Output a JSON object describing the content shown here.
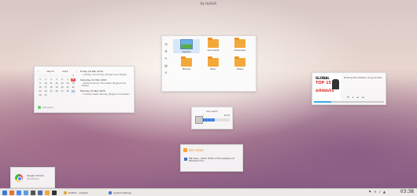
{
  "page": {
    "title": "By HalFeR"
  },
  "calendar": {
    "nav_prev": "‹",
    "month": "March",
    "year": "2015",
    "nav_next": "›",
    "days": [
      "",
      "",
      "",
      "",
      "",
      "",
      "1",
      "2",
      "3",
      "4",
      "5",
      "6",
      "7",
      "8",
      "9",
      "10",
      "11",
      "12",
      "13",
      "14",
      "15",
      "16",
      "17",
      "18",
      "19",
      "20",
      "21",
      "22",
      "23",
      "24",
      "25",
      "26",
      "27",
      "28",
      "29",
      "30",
      "31",
      "",
      "",
      "",
      "",
      ""
    ],
    "today_index": 13,
    "selected_index": 34,
    "events": [
      {
        "day": "Friday 20 Mar 2015",
        "text": "Holiday: Good Friday (England and Wales)"
      },
      {
        "day": "Saturday 21 Mar 2015",
        "text": "British Summer Time starts (England and Wales)"
      },
      {
        "day": "Monday 23 Mar 2015",
        "text": "Holiday: Easter Monday (England and Wales)"
      }
    ],
    "add_placeholder": "Add event..."
  },
  "folderview": {
    "tools": [
      "☰",
      "⚙",
      "✎",
      "▤",
      "✕"
    ],
    "items": [
      {
        "label": "Desktop",
        "kind": "desktop",
        "selected": true
      },
      {
        "label": "Documents",
        "kind": "folder",
        "selected": false
      },
      {
        "label": "Downloads",
        "kind": "folder",
        "selected": false
      },
      {
        "label": "Pictures",
        "kind": "folder",
        "selected": false
      },
      {
        "label": "Music",
        "kind": "folder",
        "selected": false
      },
      {
        "label": "Videos",
        "kind": "folder",
        "selected": false
      }
    ]
  },
  "music": {
    "cover_line1": "GLOBAL",
    "cover_line2": "TOP 15",
    "cover_line3": "AIRWAVES",
    "title": "Nothing Else Matters (Original Mix)",
    "controls": [
      "⏮",
      "⏸",
      "⏭",
      "⏭"
    ],
    "progress": 0.25,
    "accent": "#3daee9"
  },
  "disk": {
    "header": "Disk Watch",
    "left": "/",
    "right": "98 GB",
    "used_fraction": 0.45
  },
  "rss": {
    "header": "BBC NEWS",
    "items": [
      {
        "text": "BBC News - Watch: Britain's first Alphabet and Wikipedia from..."
      }
    ]
  },
  "notification": {
    "title": "Google Chrome",
    "subtitle": "Web Browser"
  },
  "taskbar": {
    "launchers": [
      {
        "name": "start-icon",
        "color": "#3a7bd5"
      },
      {
        "name": "firefox-icon",
        "color": "#e8742a"
      },
      {
        "name": "chrome-icon",
        "color": "#4a8af4"
      },
      {
        "name": "files-icon",
        "color": "#5aa0e0"
      },
      {
        "name": "headphones-icon",
        "color": "#555555"
      },
      {
        "name": "monitor-icon",
        "color": "#4a6fa5"
      },
      {
        "name": "folder-icon",
        "color": "#f3a93a"
      },
      {
        "name": "terminal-icon",
        "color": "#333333"
      }
    ],
    "tasks": [
      {
        "label": "HalFeR — Dolphin",
        "color": "#e0a94a"
      },
      {
        "label": "System Settings",
        "color": "#4b7bd1"
      }
    ],
    "tray": [
      "⚑",
      "✕",
      "♪",
      "▲"
    ],
    "clock": "03:38"
  }
}
